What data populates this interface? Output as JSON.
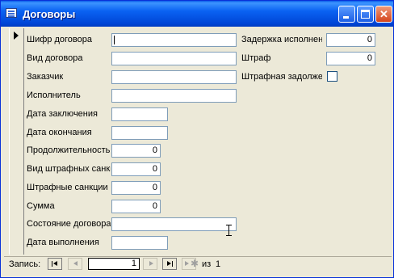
{
  "window": {
    "title": "Договоры"
  },
  "icons": {
    "app": "form-icon",
    "minimize": "minimize-icon",
    "maximize": "maximize-icon",
    "close": "close-icon",
    "record_marker": "record-selector-arrow-icon",
    "cursor": "i-beam-cursor-icon"
  },
  "form": {
    "left_fields": [
      {
        "label": "Шифр договора",
        "value": ""
      },
      {
        "label": "Вид договора",
        "value": ""
      },
      {
        "label": "Заказчик",
        "value": ""
      },
      {
        "label": "Исполнитель",
        "value": ""
      },
      {
        "label": "Дата заключения",
        "value": ""
      },
      {
        "label": "Дата окончания",
        "value": ""
      },
      {
        "label": "Продолжительность",
        "value": "0"
      },
      {
        "label": "Вид штрафных санкций",
        "value": "0"
      },
      {
        "label": "Штрафные санкции",
        "value": "0"
      },
      {
        "label": "Сумма",
        "value": "0"
      },
      {
        "label": "Состояние договора",
        "value": ""
      },
      {
        "label": "Дата выполнения",
        "value": ""
      }
    ],
    "right_fields": [
      {
        "label": "Задержка исполнения",
        "value": "0"
      },
      {
        "label": "Штраф",
        "value": "0"
      },
      {
        "label": "Штрафная задолженность",
        "checked": false
      }
    ]
  },
  "navigation": {
    "label": "Запись:",
    "current_record": "1",
    "of_label": "из",
    "total_records": "1"
  }
}
